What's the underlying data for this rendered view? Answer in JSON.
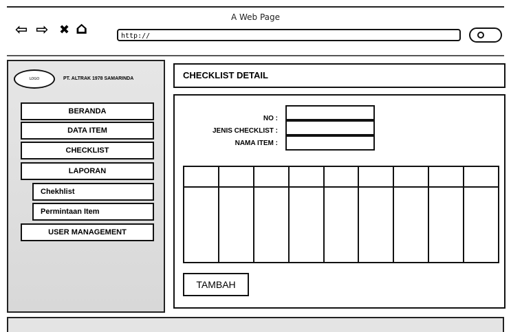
{
  "window": {
    "title": "A Web Page"
  },
  "toolbar": {
    "back_icon": "⇦",
    "forward_icon": "⇨",
    "close_icon": "✖",
    "home_icon": "⌂",
    "url": "http://"
  },
  "sidebar": {
    "logo_text": "LOGO",
    "company": "PT. ALTRAK 1978 SAMARINDA",
    "menu": [
      {
        "label": "BERANDA"
      },
      {
        "label": "DATA ITEM"
      },
      {
        "label": "CHECKLIST"
      },
      {
        "label": "LAPORAN"
      }
    ],
    "submenu": [
      {
        "label": "Chekhlist"
      },
      {
        "label": "Permintaan Item"
      }
    ],
    "user_management": "USER MANAGEMENT"
  },
  "main": {
    "title": "CHECKLIST DETAIL",
    "fields": [
      {
        "label": "NO :"
      },
      {
        "label": "JENIS CHECKLIST :"
      },
      {
        "label": "NAMA ITEM :"
      }
    ],
    "add_button": "TAMBAH"
  }
}
